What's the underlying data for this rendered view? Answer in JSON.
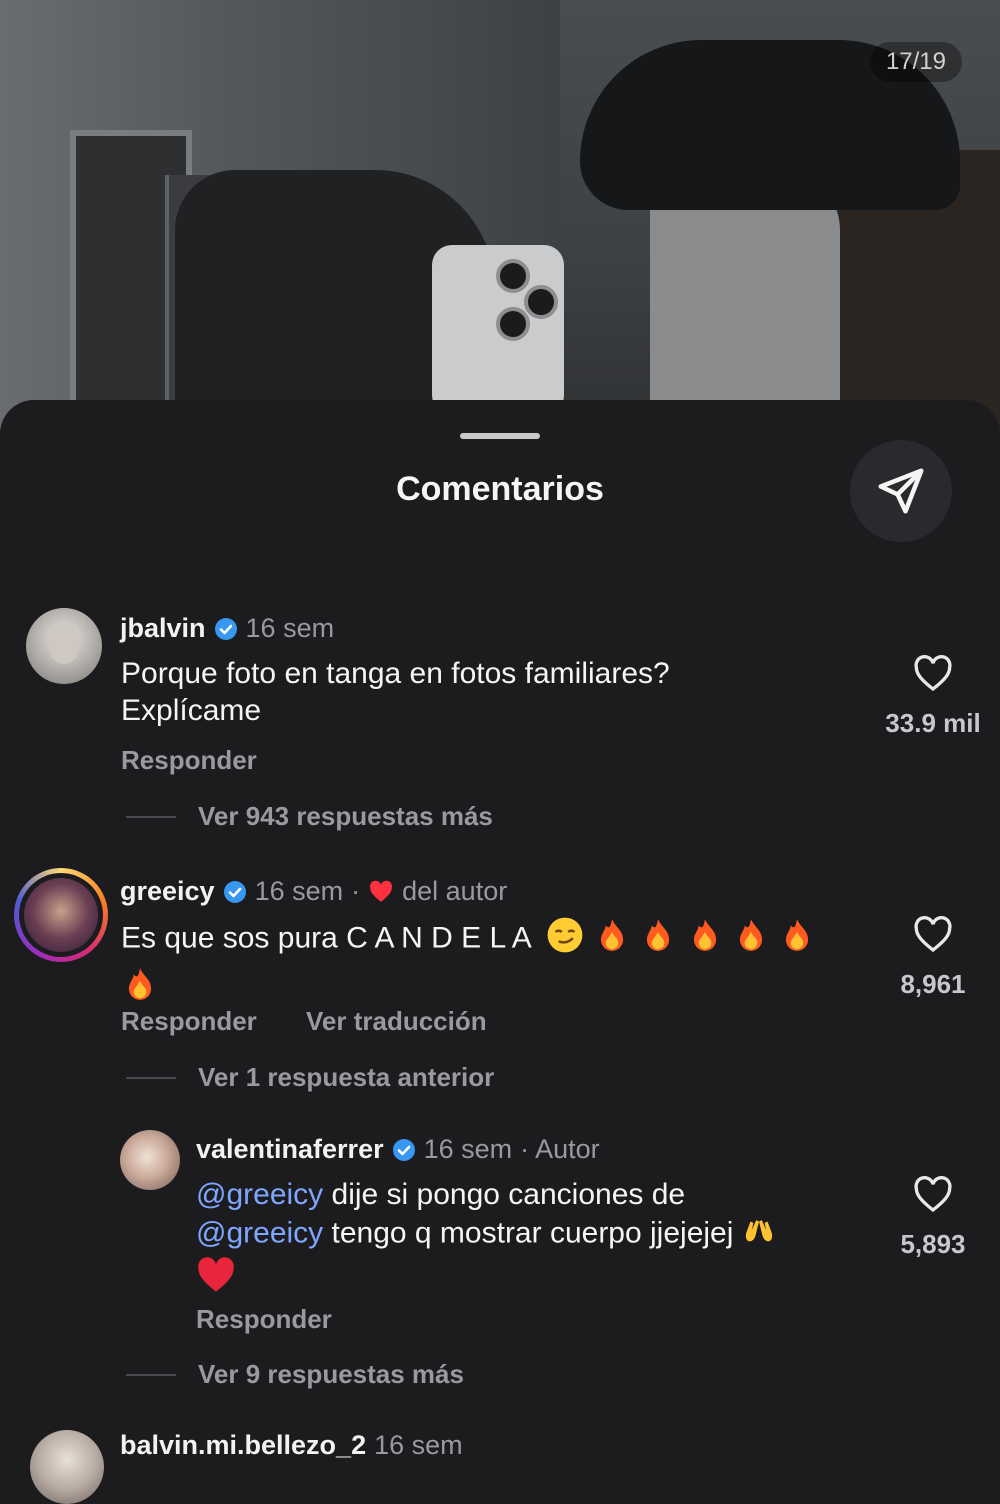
{
  "post": {
    "counter": "17/19"
  },
  "sheet": {
    "title": "Comentarios"
  },
  "comments": [
    {
      "username": "jbalvin",
      "time": "16 sem",
      "text_line1": "Porque foto en tanga en fotos familiares?",
      "text_line2": "Explícame",
      "reply": "Responder",
      "likes": "33.9 mil",
      "thread": "Ver 943 respuestas más"
    },
    {
      "username": "greeicy",
      "time": "16 sem",
      "separator": "·",
      "author_like": "del autor",
      "text": "Es que sos pura C A N D E L A",
      "reply": "Responder",
      "translate": "Ver traducción",
      "likes": "8,961",
      "thread": "Ver 1 respuesta anterior"
    },
    {
      "username": "valentinaferrer",
      "time": "16 sem",
      "author_tag": "· Autor",
      "mention": "@greeicy",
      "text_line1": " dije si pongo canciones de",
      "text_line2": " tengo q mostrar cuerpo jjejejej",
      "reply": "Responder",
      "likes": "5,893",
      "thread": "Ver 9 respuestas más"
    },
    {
      "username": "balvin.mi.bellezo_2",
      "time": "16 sem"
    }
  ],
  "colors": {
    "background": "#1c1c1f",
    "verified": "#3897f0",
    "mention": "#7ea6ff",
    "heart": "#ff3040"
  }
}
